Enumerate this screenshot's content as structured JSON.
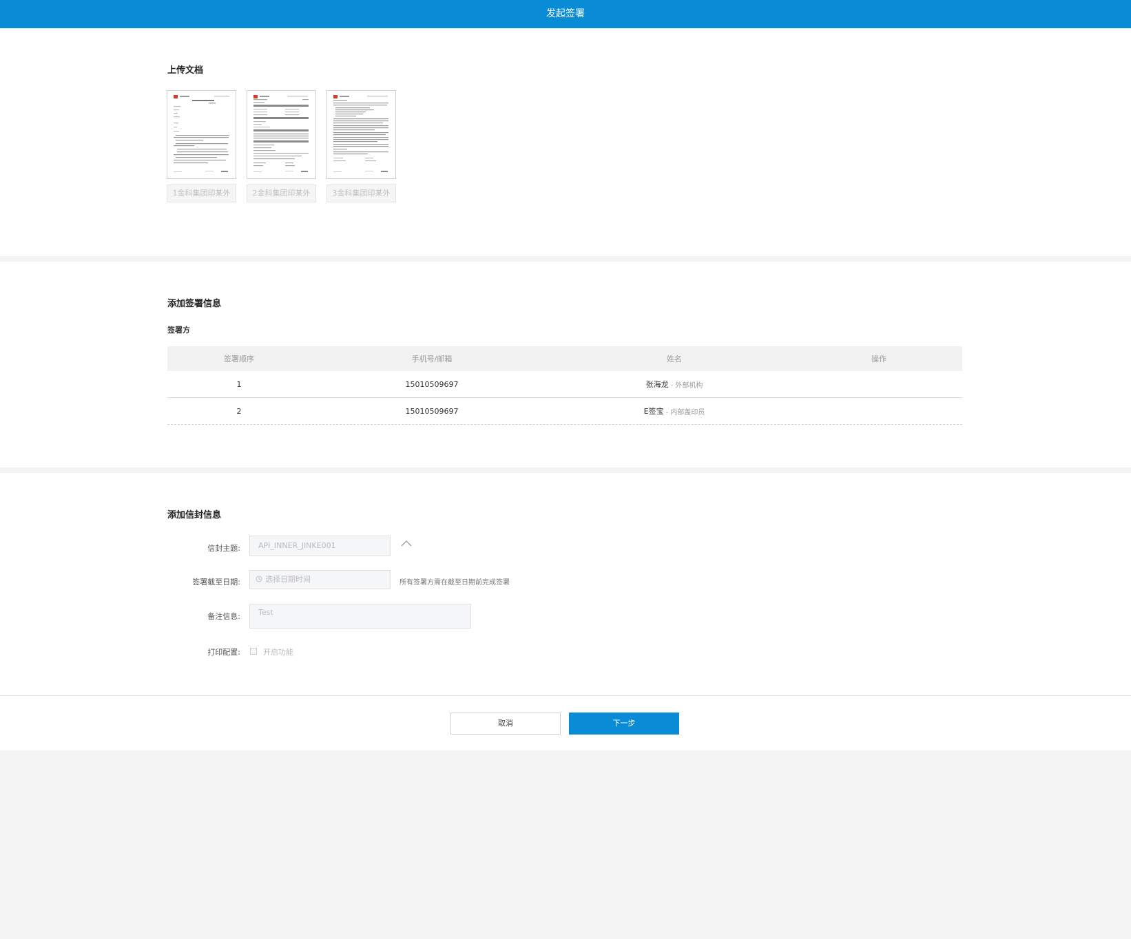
{
  "header": {
    "title": "发起签署"
  },
  "upload": {
    "title": "上传文档",
    "documents": [
      {
        "name": "1金科集团印某外"
      },
      {
        "name": "2金科集团印某外"
      },
      {
        "name": "3金科集团印某外"
      }
    ]
  },
  "signing": {
    "title": "添加签署信息",
    "subtitle": "签署方",
    "columns": [
      "签署顺序",
      "手机号/邮箱",
      "姓名",
      "操作"
    ],
    "rows": [
      {
        "order": "1",
        "contact": "15010509697",
        "name": "张海龙",
        "role": "- 外部机构"
      },
      {
        "order": "2",
        "contact": "15010509697",
        "name": "E签宝",
        "role": "- 内部盖印员"
      }
    ]
  },
  "envelope": {
    "title": "添加信封信息",
    "subject_label": "信封主题:",
    "subject_value": "API_INNER_JINKE001",
    "deadline_label": "签署截至日期:",
    "deadline_placeholder": "选择日期时间",
    "deadline_hint": "所有签署方需在截至日期前完成签署",
    "note_label": "备注信息:",
    "note_value": "Test",
    "print_label": "打印配置:",
    "print_option": "开启功能"
  },
  "actions": {
    "cancel": "取消",
    "next": "下一步"
  },
  "colors": {
    "primary": "#0a8bd6",
    "logo_red": "#d23a2a"
  }
}
